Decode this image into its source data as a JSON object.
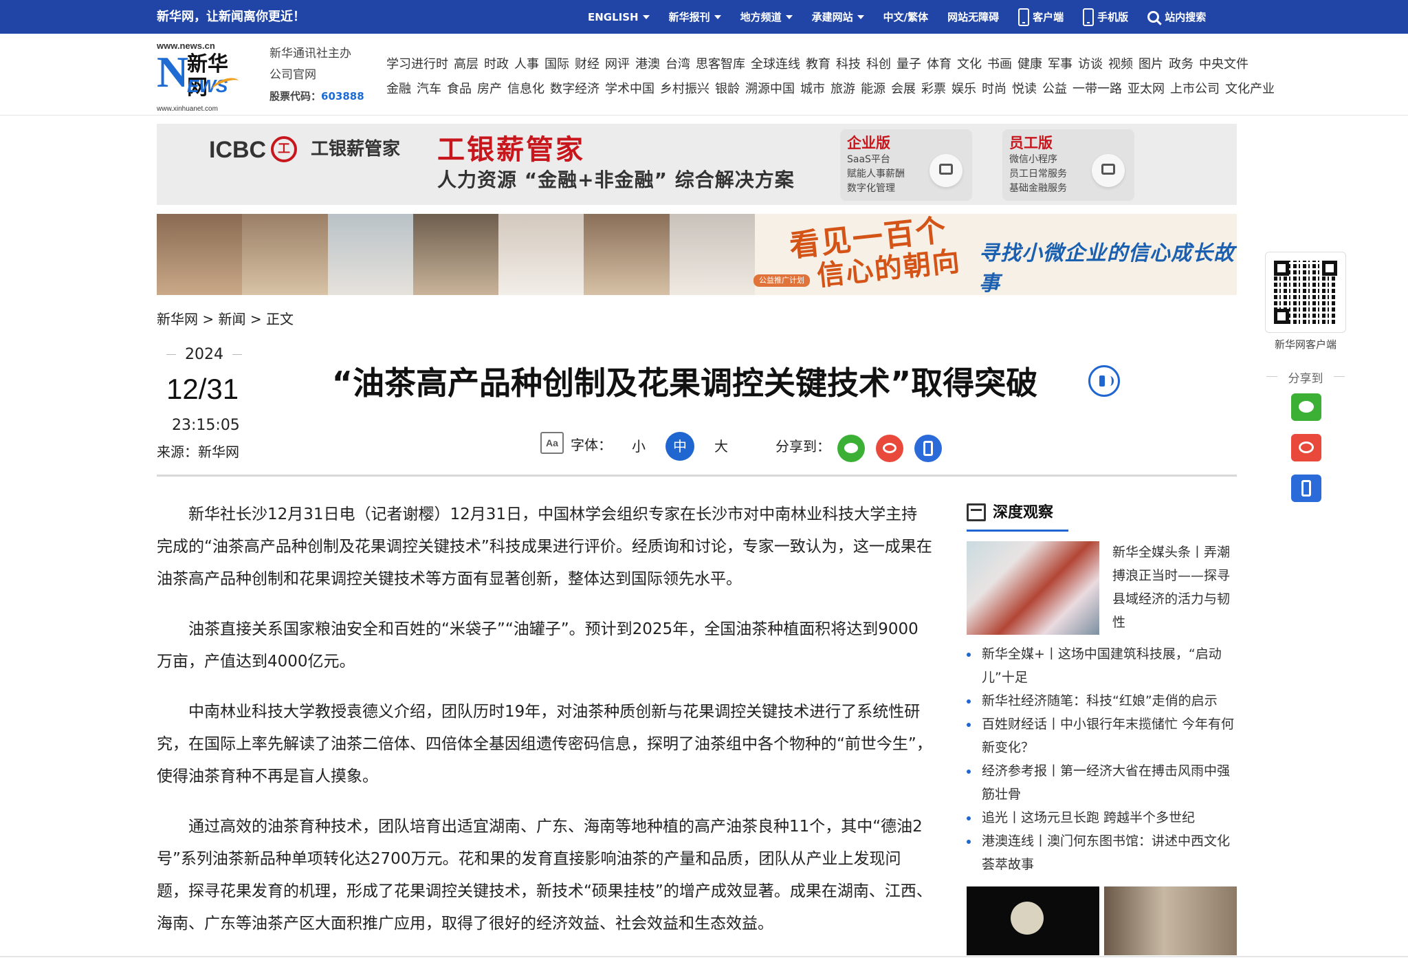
{
  "topbar": {
    "slogan": "新华网，让新闻离你更近！",
    "nav": [
      {
        "label": "ENGLISH",
        "dropdown": true
      },
      {
        "label": "新华报刊",
        "dropdown": true
      },
      {
        "label": "地方频道",
        "dropdown": true
      },
      {
        "label": "承建网站",
        "dropdown": true
      },
      {
        "label": "中文/繁体",
        "dropdown": false
      },
      {
        "label": "网站无障碍",
        "dropdown": false
      }
    ],
    "client_label": "客户端",
    "mobile_label": "手机版",
    "search_label": "站内搜索",
    "bg_color": "#2145a6"
  },
  "header": {
    "logo": {
      "url_top": "www.news.cn",
      "mark_n": "N",
      "mark_cn": "新华网",
      "mark_ews": "EWS",
      "url_bottom": "www.xinhuanet.com"
    },
    "org_line1": "新华通讯社主办",
    "org_line2": "公司官网",
    "stock_label": "股票代码：",
    "stock_code": "603888",
    "nav_row1": [
      "学习进行时",
      "高层",
      "时政",
      "人事",
      "国际",
      "财经",
      "网评",
      "港澳",
      "台湾",
      "思客智库",
      "全球连线",
      "教育",
      "科技",
      "科创",
      "量子",
      "体育",
      "文化",
      "书画",
      "健康",
      "军事",
      "访谈",
      "视频",
      "图片",
      "政务",
      "中央文件"
    ],
    "nav_row2": [
      "金融",
      "汽车",
      "食品",
      "房产",
      "信息化",
      "数字经济",
      "学术中国",
      "乡村振兴",
      "银龄",
      "溯源中国",
      "城市",
      "旅游",
      "能源",
      "会展",
      "彩票",
      "娱乐",
      "时尚",
      "悦读",
      "公益",
      "一带一路",
      "亚太网",
      "上市公司",
      "文化产业"
    ]
  },
  "ad_icbc": {
    "logo_en": "ICBC",
    "logo_mark": "工",
    "logo_cn": "工银薪管家",
    "headline": "工银薪管家",
    "tagline": "人力资源 “金融+非金融” 综合解决方案",
    "cards": [
      {
        "title": "企业版",
        "lines": [
          "SaaS平台",
          "赋能人事薪酬",
          "数字化管理"
        ]
      },
      {
        "title": "员工版",
        "lines": [
          "微信小程序",
          "员工日常服务",
          "基础金融服务"
        ]
      }
    ]
  },
  "ad_banner": {
    "headline_1": "看见一百个",
    "headline_2": "信心的朝向",
    "pill": "公益推广计划",
    "subline": "寻找小微企业的信心成长故事"
  },
  "breadcrumb": "新华网 > 新闻 > 正文",
  "meta": {
    "year": "2024",
    "date": "12/31",
    "time": "23:15:05",
    "source": "来源：新华网"
  },
  "article": {
    "title": "“油茶高产品种创制及花果调控关键技术”取得突破",
    "font_label": "字体：",
    "font_sizes": [
      "小",
      "中",
      "大"
    ],
    "font_active": "中",
    "font_icon_text": "Aa",
    "share_label": "分享到：",
    "paragraphs": [
      "新华社长沙12月31日电（记者谢樱）12月31日，中国林学会组织专家在长沙市对中南林业科技大学主持完成的“油茶高产品种创制及花果调控关键技术”科技成果进行评价。经质询和讨论，专家一致认为，这一成果在油茶高产品种创制和花果调控关键技术等方面有显著创新，整体达到国际领先水平。",
      "油茶直接关系国家粮油安全和百姓的“米袋子”“油罐子”。预计到2025年，全国油茶种植面积将达到9000万亩，产值达到4000亿元。",
      "中南林业科技大学教授袁德义介绍，团队历时19年，对油茶种质创新与花果调控关键技术进行了系统性研究，在国际上率先解读了油茶二倍体、四倍体全基因组遗传密码信息，探明了油茶组中各个物种的“前世今生”，使得油茶育种不再是盲人摸象。",
      "通过高效的油茶育种技术，团队培育出适宜湖南、广东、海南等地种植的高产油茶良种11个，其中“德油2号”系列油茶新品种单项转化达2700万元。花和果的发育直接影响油茶的产量和品质，团队从产业上发现问题，探寻花果发育的机理，形成了花果调控关键技术，新技术“硕果挂枝”的增产成效显著。成果在湖南、江西、海南、广东等油茶产区大面积推广应用，取得了很好的经济效益、社会效益和生态效益。"
    ]
  },
  "sidebar": {
    "title": "深度观察",
    "featured": "新华全媒头条丨弄潮搏浪正当时——探寻县域经济的活力与韧性",
    "items": [
      "新华全媒+丨这场中国建筑科技展，“启动儿”十足",
      "新华社经济随笔：科技“红娘”走俏的启示",
      "百姓财经话丨中小银行年末揽储忙 今年有何新变化？",
      "经济参考报丨第一经济大省在搏击风雨中强筋壮骨",
      "追光丨这场元旦长跑 跨越半个多世纪",
      "港澳连线丨澳门何东图书馆：讲述中西文化荟萃故事"
    ]
  },
  "floater": {
    "qr_caption": "新华网客户端",
    "share_title": "分享到"
  }
}
